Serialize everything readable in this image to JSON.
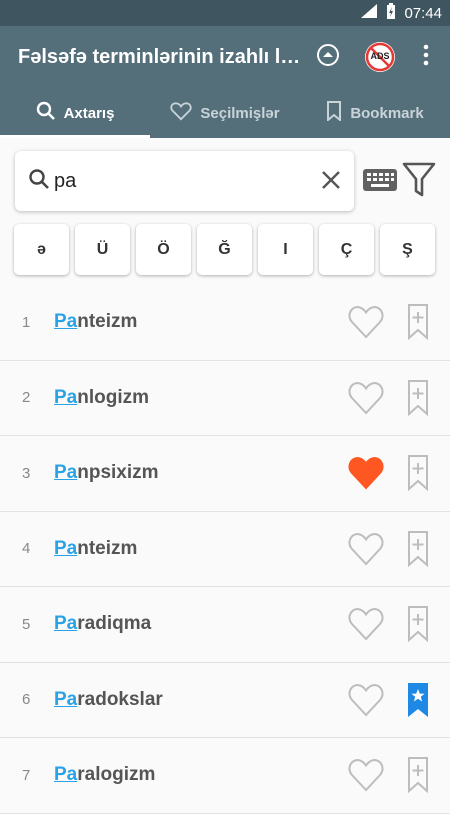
{
  "status": {
    "time": "07:44"
  },
  "app": {
    "title": "Fəlsəfə terminlərinin izahlı lüğəti",
    "ads_label": "ADS"
  },
  "tabs": [
    {
      "label": "Axtarış",
      "icon": "search-icon",
      "active": true
    },
    {
      "label": "Seçilmişlər",
      "icon": "heart-outline-icon",
      "active": false
    },
    {
      "label": "Bookmark",
      "icon": "bookmark-outline-icon",
      "active": false
    }
  ],
  "search": {
    "value": "pa",
    "placeholder": ""
  },
  "letters": [
    "ə",
    "Ü",
    "Ö",
    "Ğ",
    "I",
    "Ç",
    "Ş"
  ],
  "results": [
    {
      "num": "1",
      "match": "Pa",
      "rest": "nteizm",
      "favorite": false,
      "bookmarked": false
    },
    {
      "num": "2",
      "match": "Pa",
      "rest": "nlogizm",
      "favorite": false,
      "bookmarked": false
    },
    {
      "num": "3",
      "match": "Pa",
      "rest": "npsixizm",
      "favorite": true,
      "bookmarked": false
    },
    {
      "num": "4",
      "match": "Pa",
      "rest": "nteizm",
      "favorite": false,
      "bookmarked": false
    },
    {
      "num": "5",
      "match": "Pa",
      "rest": "radiqma",
      "favorite": false,
      "bookmarked": false
    },
    {
      "num": "6",
      "match": "Pa",
      "rest": "radokslar",
      "favorite": false,
      "bookmarked": true
    },
    {
      "num": "7",
      "match": "Pa",
      "rest": "ralogizm",
      "favorite": false,
      "bookmarked": false
    }
  ],
  "colors": {
    "appbar": "#546e7a",
    "statusbar": "#3f5661",
    "highlight": "#29a3e6",
    "favorite": "#ff5722",
    "bookmark": "#1e88e5"
  }
}
